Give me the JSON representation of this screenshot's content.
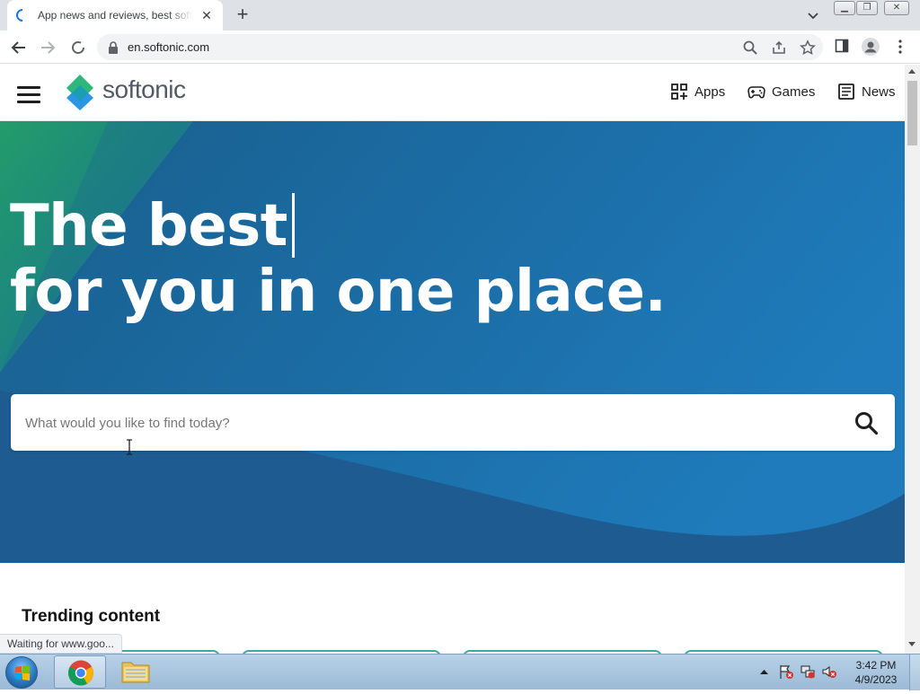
{
  "browser": {
    "tab_title": "App news and reviews, best software downloads and discovery",
    "url": "en.softonic.com",
    "status_text": "Waiting for www.goo..."
  },
  "site": {
    "logo_text": "softonic",
    "nav": [
      {
        "label": "Apps",
        "icon": "apps-grid-icon"
      },
      {
        "label": "Games",
        "icon": "gamepad-icon"
      },
      {
        "label": "News",
        "icon": "newspaper-icon"
      }
    ]
  },
  "hero": {
    "line1": "The best",
    "line2": "for you in one place.",
    "search_placeholder": "What would you like to find today?"
  },
  "trending": {
    "heading": "Trending content"
  },
  "taskbar": {
    "time": "3:42 PM",
    "date": "4/9/2023"
  },
  "colors": {
    "hero_blue": "#1a6fa9",
    "hero_green": "#1f9a6a",
    "logo_green": "#2fb67a",
    "logo_blue": "#1f8fe0",
    "card_border": "#3aa9a0"
  }
}
